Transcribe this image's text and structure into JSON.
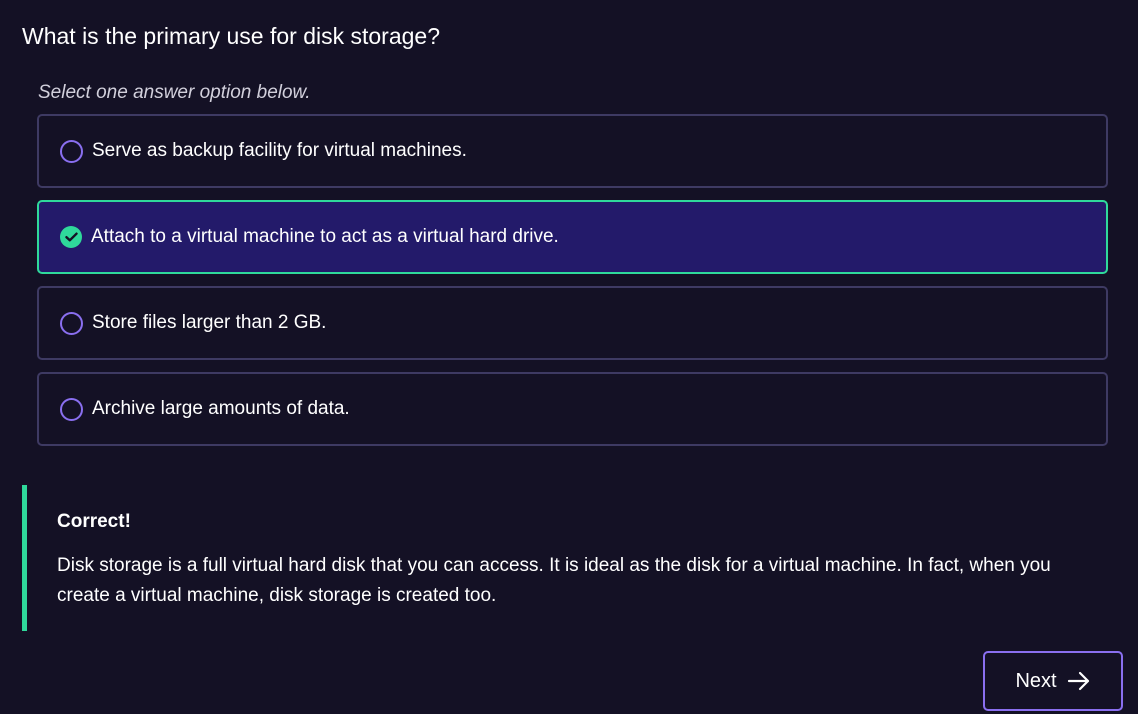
{
  "question": {
    "text": "What is the primary use for disk storage?",
    "instruction": "Select one answer option below."
  },
  "options": [
    {
      "label": "Serve as backup facility for virtual machines.",
      "selected": false
    },
    {
      "label": "Attach to a virtual machine to act as a virtual hard drive.",
      "selected": true
    },
    {
      "label": "Store files larger than 2 GB.",
      "selected": false
    },
    {
      "label": "Archive large amounts of data.",
      "selected": false
    }
  ],
  "feedback": {
    "title": "Correct!",
    "body": "Disk storage is a full virtual hard disk that you can access. It is ideal as the disk for a virtual machine. In fact, when you create a virtual machine, disk storage is created too."
  },
  "navigation": {
    "next_label": "Next"
  },
  "icons": {
    "unselected": "radio-unchecked-icon",
    "selected": "checkmark-circle-icon",
    "next": "arrow-right-icon"
  },
  "colors": {
    "background": "#141125",
    "selected_background": "#231a6a",
    "correct_accent": "#2fd99b",
    "primary_accent": "#8a6ff0",
    "option_border": "#3e3a63"
  }
}
